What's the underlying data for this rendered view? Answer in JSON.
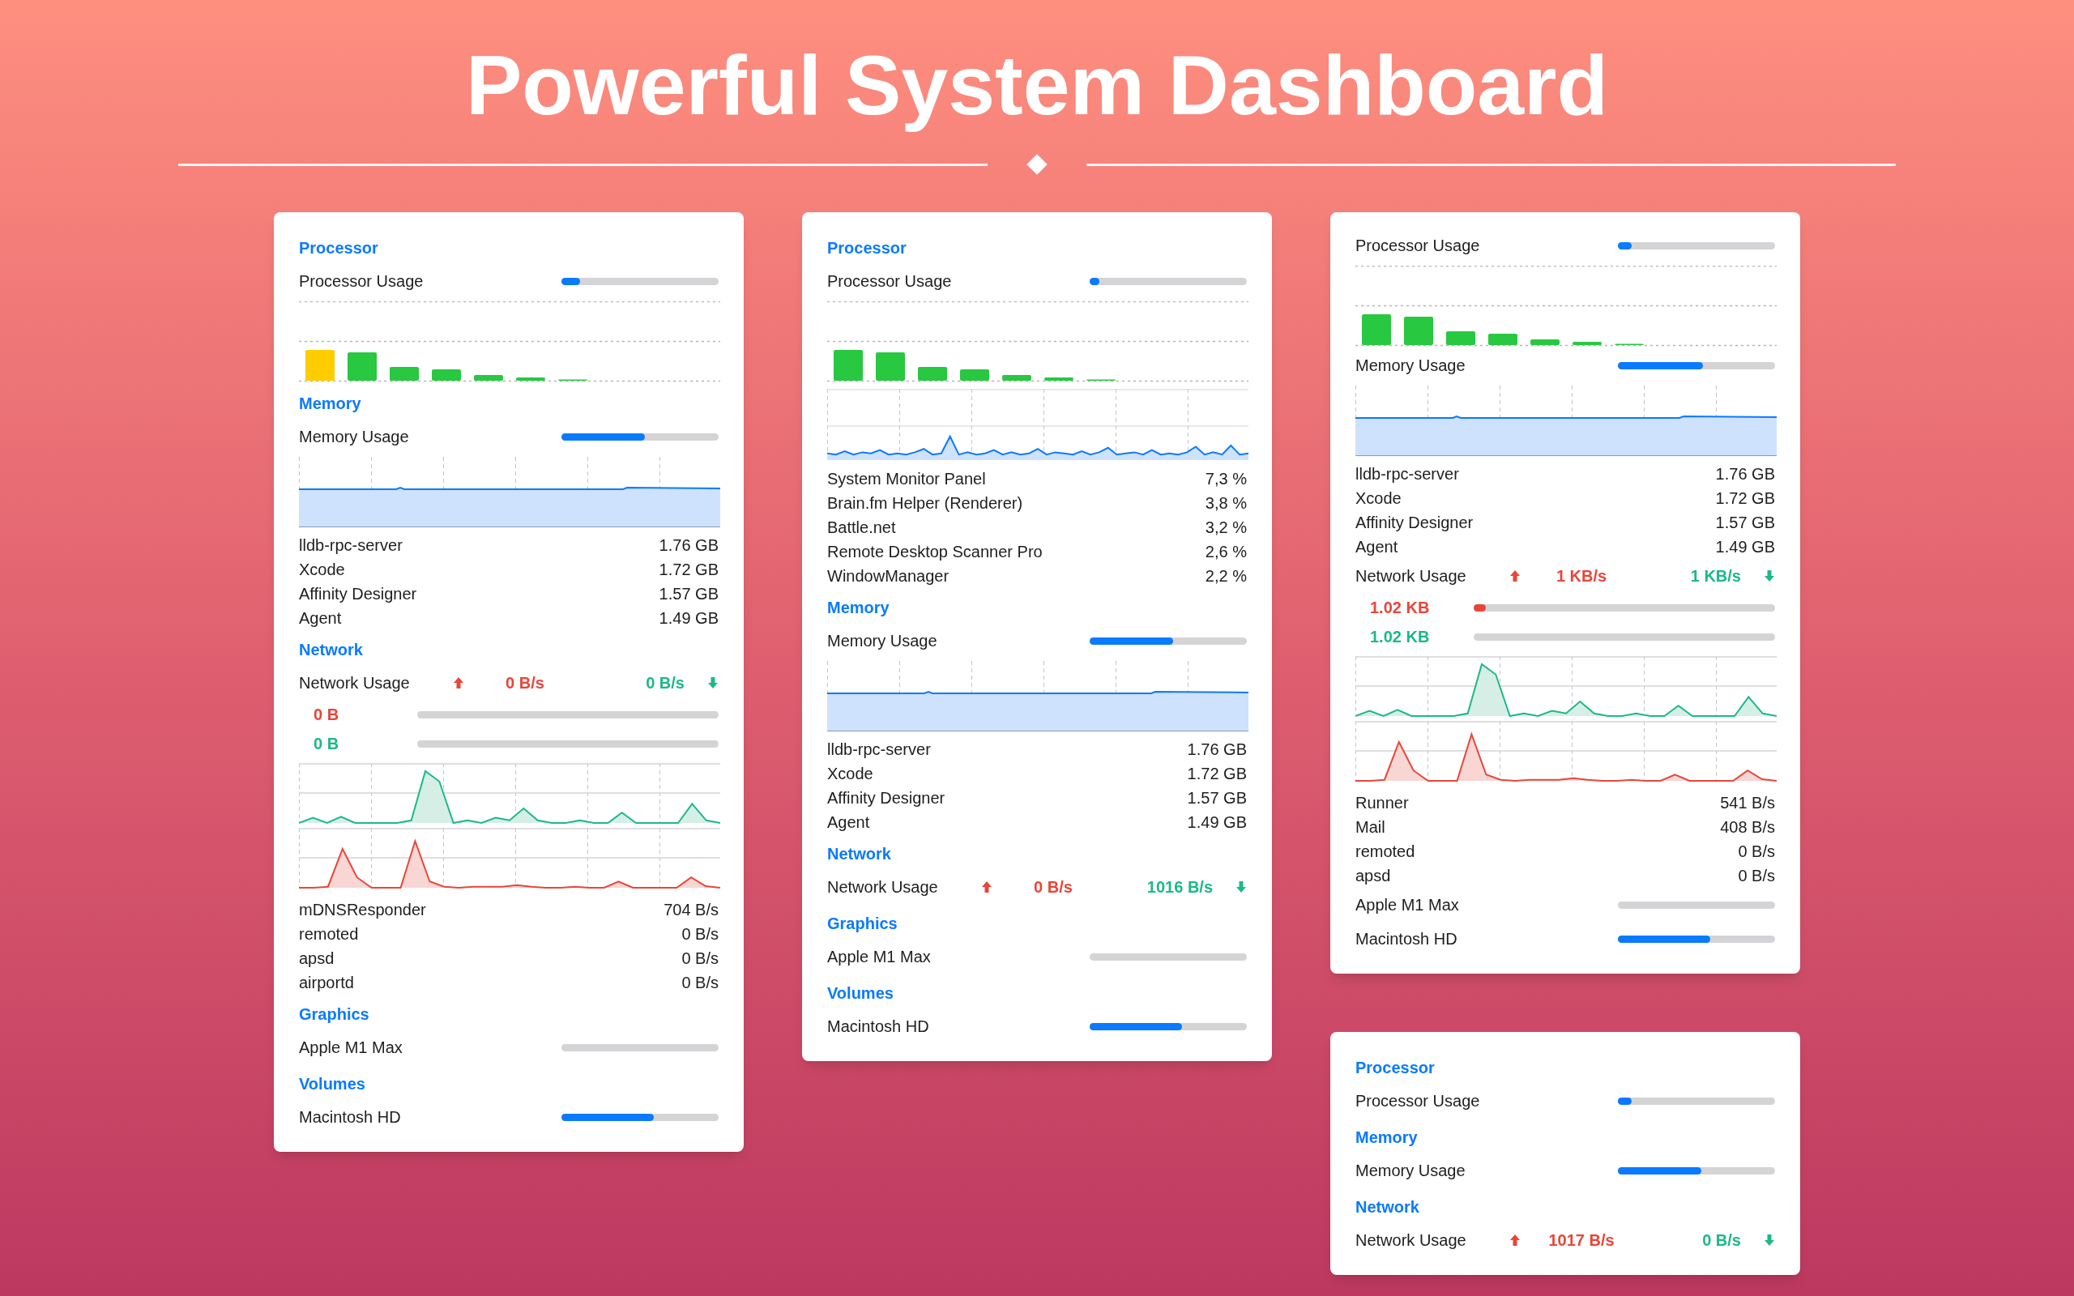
{
  "title": "Powerful System Dashboard",
  "panels": [
    {
      "blocks": [
        {
          "kind": "heading",
          "text": "Processor"
        },
        {
          "kind": "meter",
          "label": "Processor Usage",
          "level": 0.12
        },
        {
          "kind": "cpu_bars",
          "first_bar_warning": true
        },
        {
          "kind": "heading",
          "text": "Memory"
        },
        {
          "kind": "meter",
          "label": "Memory Usage",
          "level": 0.53
        },
        {
          "kind": "memory_graph"
        },
        {
          "kind": "rows",
          "rows": [
            {
              "name": "lldb-rpc-server",
              "value": "1.76 GB"
            },
            {
              "name": "Xcode",
              "value": "1.72 GB"
            },
            {
              "name": "Affinity Designer",
              "value": "1.57 GB"
            },
            {
              "name": "Agent",
              "value": "1.49 GB"
            }
          ]
        },
        {
          "kind": "heading",
          "text": "Network"
        },
        {
          "kind": "network",
          "label": "Network Usage",
          "up": "0 B/s",
          "down": "0 B/s"
        },
        {
          "kind": "transfer_up",
          "text": "0 B",
          "level": 0
        },
        {
          "kind": "transfer_down",
          "text": "0 B",
          "level": 0
        },
        {
          "kind": "network_graphs"
        },
        {
          "kind": "rows",
          "rows": [
            {
              "name": "mDNSResponder",
              "value": "704 B/s"
            },
            {
              "name": "remoted",
              "value": "0 B/s"
            },
            {
              "name": "apsd",
              "value": "0 B/s"
            },
            {
              "name": "airportd",
              "value": "0 B/s"
            }
          ]
        },
        {
          "kind": "heading",
          "text": "Graphics"
        },
        {
          "kind": "meter",
          "label": "Apple M1 Max",
          "level": 0
        },
        {
          "kind": "heading",
          "text": "Volumes"
        },
        {
          "kind": "meter",
          "label": "Macintosh HD",
          "level": 0.59
        }
      ]
    },
    {
      "blocks": [
        {
          "kind": "heading",
          "text": "Processor"
        },
        {
          "kind": "meter",
          "label": "Processor Usage",
          "level": 0.06
        },
        {
          "kind": "cpu_bars",
          "first_bar_warning": false
        },
        {
          "kind": "cpu_history"
        },
        {
          "kind": "rows",
          "rows": [
            {
              "name": "System Monitor Panel",
              "value": "7,3 %"
            },
            {
              "name": "Brain.fm Helper (Renderer)",
              "value": "3,8 %"
            },
            {
              "name": "Battle.net",
              "value": "3,2 %"
            },
            {
              "name": "Remote Desktop Scanner Pro",
              "value": "2,6 %"
            },
            {
              "name": "WindowManager",
              "value": "2,2 %"
            }
          ]
        },
        {
          "kind": "heading",
          "text": "Memory"
        },
        {
          "kind": "meter",
          "label": "Memory Usage",
          "level": 0.53
        },
        {
          "kind": "memory_graph"
        },
        {
          "kind": "rows",
          "rows": [
            {
              "name": "lldb-rpc-server",
              "value": "1.76 GB"
            },
            {
              "name": "Xcode",
              "value": "1.72 GB"
            },
            {
              "name": "Affinity Designer",
              "value": "1.57 GB"
            },
            {
              "name": "Agent",
              "value": "1.49 GB"
            }
          ]
        },
        {
          "kind": "heading",
          "text": "Network"
        },
        {
          "kind": "network",
          "label": "Network Usage",
          "up": "0 B/s",
          "down": "1016 B/s"
        },
        {
          "kind": "heading",
          "text": "Graphics"
        },
        {
          "kind": "meter",
          "label": "Apple M1 Max",
          "level": 0
        },
        {
          "kind": "heading",
          "text": "Volumes"
        },
        {
          "kind": "meter",
          "label": "Macintosh HD",
          "level": 0.59
        }
      ]
    },
    {
      "blocks": [
        {
          "kind": "meter",
          "label": "Processor Usage",
          "level": 0.09
        },
        {
          "kind": "cpu_bars",
          "first_bar_warning": false
        },
        {
          "kind": "meter",
          "label": "Memory Usage",
          "level": 0.54
        },
        {
          "kind": "memory_graph"
        },
        {
          "kind": "rows",
          "rows": [
            {
              "name": "lldb-rpc-server",
              "value": "1.76 GB"
            },
            {
              "name": "Xcode",
              "value": "1.72 GB"
            },
            {
              "name": "Affinity Designer",
              "value": "1.57 GB"
            },
            {
              "name": "Agent",
              "value": "1.49 GB"
            }
          ]
        },
        {
          "kind": "network",
          "label": "Network Usage",
          "up": "1 KB/s",
          "down": "1 KB/s"
        },
        {
          "kind": "transfer_up",
          "text": "1.02 KB",
          "level": 0.04
        },
        {
          "kind": "transfer_down",
          "text": "1.02 KB",
          "level": 0
        },
        {
          "kind": "network_graphs"
        },
        {
          "kind": "rows",
          "rows": [
            {
              "name": "Runner",
              "value": "541 B/s"
            },
            {
              "name": "Mail",
              "value": "408 B/s"
            },
            {
              "name": "remoted",
              "value": "0 B/s"
            },
            {
              "name": "apsd",
              "value": "0 B/s"
            }
          ]
        },
        {
          "kind": "meter",
          "label": "Apple M1 Max",
          "level": 0
        },
        {
          "kind": "meter",
          "label": "Macintosh HD",
          "level": 0.59
        }
      ]
    },
    {
      "blocks": [
        {
          "kind": "heading",
          "text": "Processor"
        },
        {
          "kind": "meter",
          "label": "Processor Usage",
          "level": 0.09
        },
        {
          "kind": "heading",
          "text": "Memory"
        },
        {
          "kind": "meter",
          "label": "Memory Usage",
          "level": 0.53
        },
        {
          "kind": "heading",
          "text": "Network"
        },
        {
          "kind": "network",
          "label": "Network Usage",
          "up": "1017 B/s",
          "down": "0 B/s"
        }
      ]
    }
  ]
}
